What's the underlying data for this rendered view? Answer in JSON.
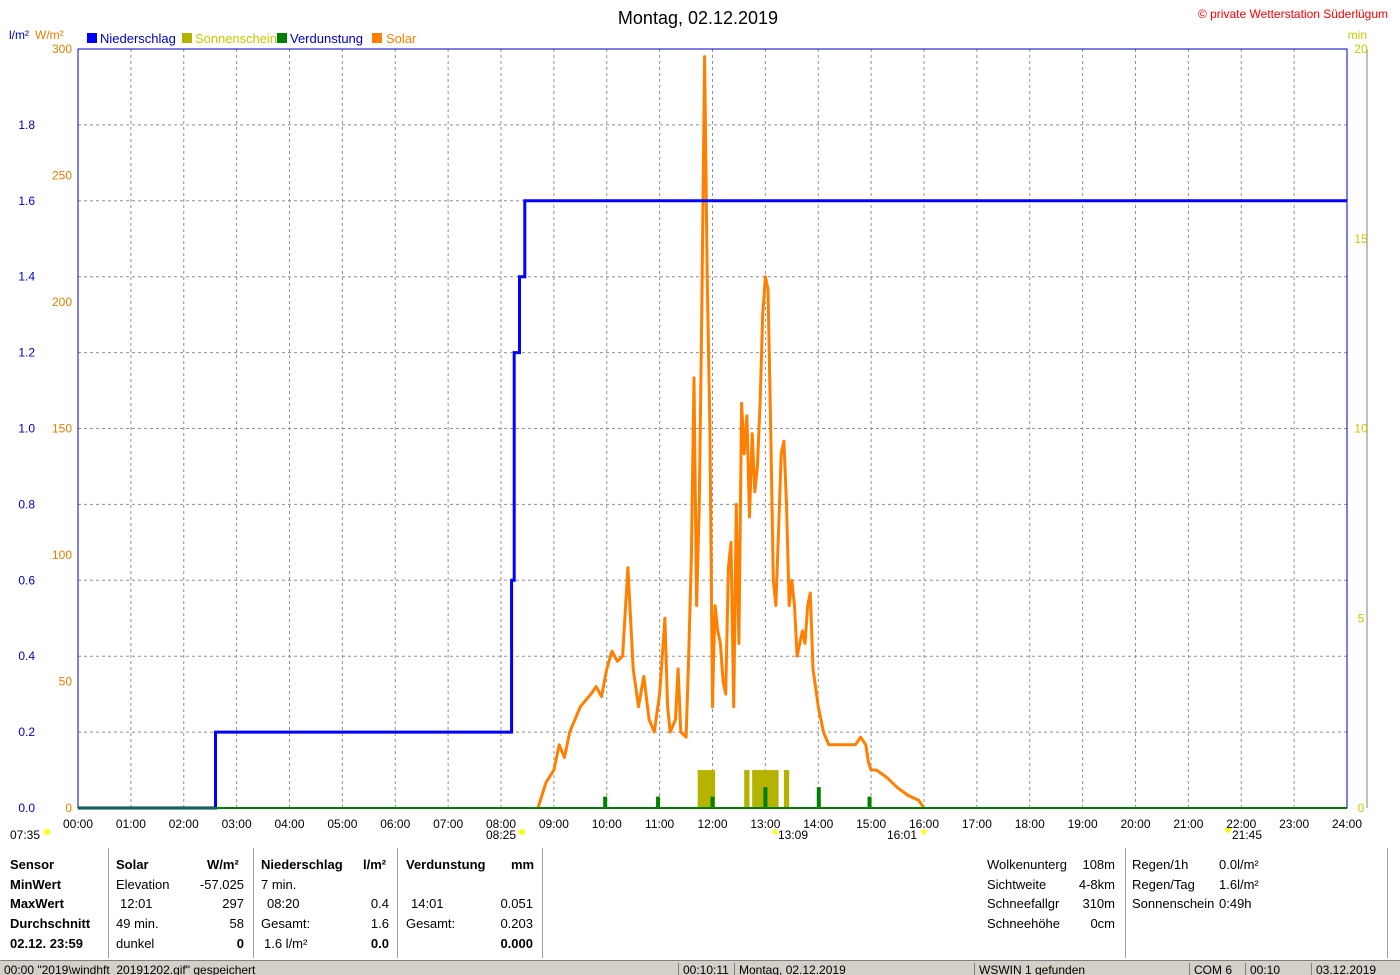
{
  "title": "Montag, 02.12.2019",
  "copyright": "© private Wetterstation Süderlügum",
  "units": {
    "left1": "l/m²",
    "left2": "W/m²",
    "right": "min"
  },
  "colors": {
    "niederschlag": "#0000ff",
    "sonnenschein": "#b4b400",
    "verdunstung": "#008000",
    "solar": "#ff8000",
    "axis_left_precip": "#0000c0",
    "axis_left_solar": "#e08000",
    "axis_right": "#c8c800",
    "copyright": "#ff0000"
  },
  "markers": {
    "sunrise": "08:25",
    "sunset": "16:01",
    "left_time": "07:35",
    "solar_noon": "13:09",
    "right_time": "21:45"
  },
  "chart_data": {
    "type": "line",
    "legend": [
      "Niederschlag",
      "Sonnenschein",
      "Verdunstung",
      "Solar"
    ],
    "xlim": [
      "00:00",
      "24:00"
    ],
    "x_ticks": [
      "00:00",
      "01:00",
      "02:00",
      "03:00",
      "04:00",
      "05:00",
      "06:00",
      "07:00",
      "08:00",
      "09:00",
      "10:00",
      "11:00",
      "12:00",
      "13:00",
      "14:00",
      "15:00",
      "16:00",
      "17:00",
      "18:00",
      "19:00",
      "20:00",
      "21:00",
      "22:00",
      "23:00",
      "24:00"
    ],
    "y_left_precip": {
      "ylim": [
        0,
        2.0
      ],
      "ticks": [
        "0.0",
        "0.2",
        "0.4",
        "0.6",
        "0.8",
        "1.0",
        "1.2",
        "1.4",
        "1.6",
        "1.8"
      ]
    },
    "y_left_solar": {
      "ylim": [
        0,
        300
      ],
      "ticks": [
        "0",
        "50",
        "100",
        "150",
        "200",
        "250",
        "300"
      ]
    },
    "y_right": {
      "ylim": [
        0,
        20
      ],
      "ticks": [
        "0",
        "5",
        "10",
        "15",
        "20"
      ]
    },
    "grid": true,
    "series": [
      {
        "name": "Niederschlag",
        "axis": "precip",
        "style": "step",
        "x": [
          0.0,
          2.6,
          2.6,
          8.2,
          8.2,
          8.25,
          8.25,
          8.35,
          8.35,
          8.45,
          8.45,
          24.0
        ],
        "y": [
          0.0,
          0.0,
          0.2,
          0.2,
          0.6,
          0.6,
          1.2,
          1.2,
          1.4,
          1.4,
          1.6,
          1.6
        ]
      },
      {
        "name": "Solar",
        "axis": "solar",
        "style": "line",
        "x": [
          8.7,
          8.85,
          9.0,
          9.1,
          9.2,
          9.3,
          9.5,
          9.7,
          9.8,
          9.9,
          10.0,
          10.1,
          10.2,
          10.3,
          10.4,
          10.5,
          10.6,
          10.7,
          10.8,
          10.9,
          11.0,
          11.05,
          11.1,
          11.15,
          11.2,
          11.3,
          11.35,
          11.4,
          11.5,
          11.55,
          11.6,
          11.65,
          11.7,
          11.75,
          11.8,
          11.85,
          11.9,
          11.95,
          12.0,
          12.02,
          12.05,
          12.1,
          12.15,
          12.2,
          12.25,
          12.3,
          12.35,
          12.4,
          12.45,
          12.5,
          12.55,
          12.6,
          12.65,
          12.7,
          12.75,
          12.8,
          12.85,
          12.9,
          12.95,
          13.0,
          13.05,
          13.1,
          13.15,
          13.2,
          13.25,
          13.3,
          13.35,
          13.4,
          13.45,
          13.5,
          13.55,
          13.6,
          13.7,
          13.75,
          13.8,
          13.85,
          13.9,
          14.0,
          14.1,
          14.2,
          14.3,
          14.5,
          14.7,
          14.8,
          14.9,
          14.95,
          15.0,
          15.1,
          15.3,
          15.5,
          15.7,
          15.9,
          16.0
        ],
        "y": [
          0,
          10,
          15,
          25,
          20,
          30,
          40,
          45,
          48,
          44,
          55,
          62,
          58,
          60,
          95,
          55,
          40,
          52,
          35,
          30,
          45,
          60,
          75,
          40,
          30,
          35,
          55,
          30,
          28,
          60,
          100,
          170,
          80,
          120,
          200,
          297,
          210,
          150,
          40,
          60,
          80,
          70,
          65,
          50,
          45,
          95,
          105,
          40,
          120,
          65,
          160,
          140,
          155,
          115,
          148,
          125,
          135,
          160,
          195,
          210,
          205,
          150,
          90,
          80,
          110,
          140,
          145,
          120,
          80,
          90,
          80,
          60,
          70,
          65,
          80,
          85,
          55,
          40,
          30,
          25,
          25,
          25,
          25,
          28,
          25,
          18,
          15,
          15,
          12,
          8,
          5,
          3,
          0
        ]
      },
      {
        "name": "Sonnenschein",
        "axis": "right",
        "style": "bars",
        "bars": [
          {
            "x0": 11.72,
            "x1": 12.05,
            "y": 1.0
          },
          {
            "x0": 12.6,
            "x1": 12.7,
            "y": 1.0
          },
          {
            "x0": 12.75,
            "x1": 13.25,
            "y": 1.0
          },
          {
            "x0": 13.35,
            "x1": 13.45,
            "y": 1.0
          }
        ]
      },
      {
        "name": "Verdunstung",
        "axis": "right",
        "style": "spikes",
        "spikes": [
          {
            "x": 9.97,
            "y": 0.3
          },
          {
            "x": 10.97,
            "y": 0.3
          },
          {
            "x": 12.0,
            "y": 0.3
          },
          {
            "x": 13.0,
            "y": 0.55
          },
          {
            "x": 14.01,
            "y": 0.55
          },
          {
            "x": 14.97,
            "y": 0.3
          }
        ]
      }
    ]
  },
  "table": {
    "sensor": {
      "header": "Sensor",
      "rows": [
        "MinWert",
        "MaxWert",
        "Durchschnitt",
        "02.12. 23:59"
      ]
    },
    "solar": {
      "header": "Solar",
      "unit": "W/m²",
      "rows": [
        [
          "Elevation",
          "-57.025"
        ],
        [
          "12:01",
          "297"
        ],
        [
          "49 min.",
          "58"
        ],
        [
          "dunkel",
          "0"
        ]
      ]
    },
    "niederschlag": {
      "header": "Niederschlag",
      "unit": "l/m²",
      "rows": [
        [
          "7 min.",
          ""
        ],
        [
          "08:20",
          "0.4"
        ],
        [
          "Gesamt:",
          "1.6"
        ],
        [
          "1.6 l/m²",
          "0.0"
        ]
      ]
    },
    "verdunstung": {
      "header": "Verdunstung",
      "unit": "mm",
      "rows": [
        [
          "",
          ""
        ],
        [
          "14:01",
          "0.051"
        ],
        [
          "Gesamt:",
          "0.203"
        ],
        [
          "",
          "0.000"
        ]
      ]
    },
    "wolken": [
      [
        "Wolkenunterg",
        "108m"
      ],
      [
        "Sichtweite",
        "4-8km"
      ],
      [
        "Schneefallgr",
        "310m"
      ],
      [
        "Schneehöhe",
        "0cm"
      ]
    ],
    "regen": [
      [
        "Regen/1h",
        "0.0l/m²"
      ],
      [
        "Regen/Tag",
        "1.6l/m²"
      ],
      [
        "Sonnenschein",
        "0:49h"
      ]
    ]
  },
  "statusbar": {
    "message": "00:00 \"2019\\windhft_20191202.gif\" gespeichert",
    "time1": "00:10:11",
    "date1": "Montag, 02.12.2019",
    "wswin": "WSWIN 1 gefunden",
    "com": "COM 6",
    "time2": "00:10",
    "date2": "03.12.2019"
  }
}
